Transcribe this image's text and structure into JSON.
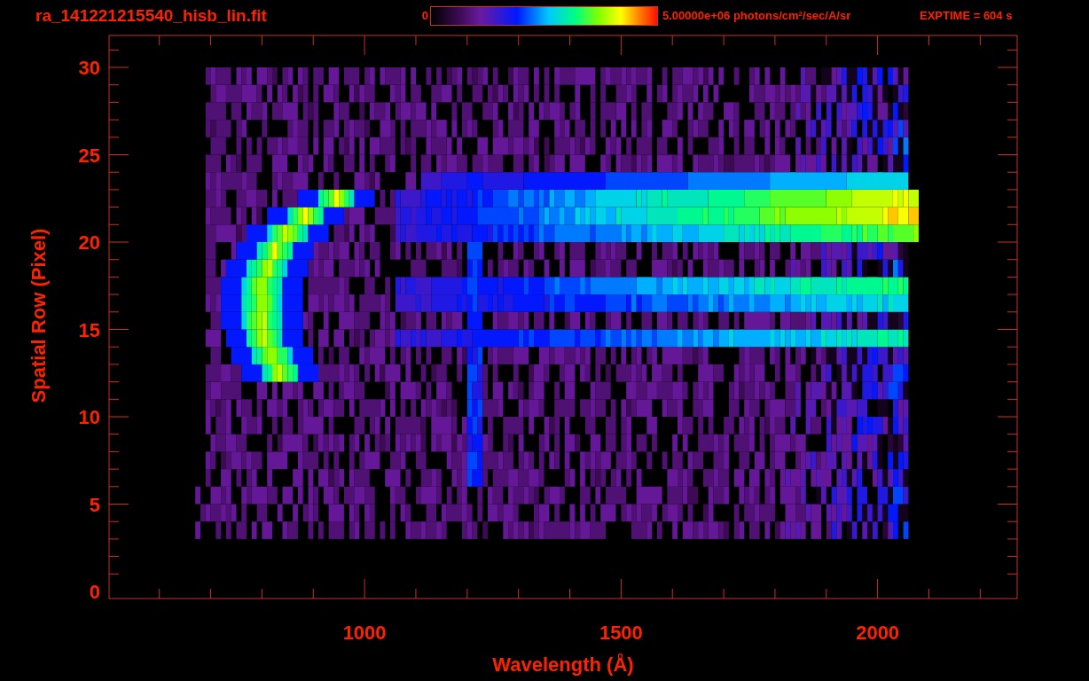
{
  "title": "ra_141221215540_hisb_lin.fit",
  "colorbar": {
    "min_label": "0",
    "max_label": "5.00000e+06 photons/cm$^{2}$/sec/A/sr"
  },
  "exptime": "EXPTIME = 604 s",
  "plot": {
    "xlabel": "Wavelength (Å)",
    "ylabel": "Spatial Row (Pixel)",
    "xticks": [
      "1000",
      "1500",
      "2000"
    ],
    "yticks": [
      "30",
      "25",
      "20",
      "15",
      "10",
      "5",
      "0"
    ]
  }
}
